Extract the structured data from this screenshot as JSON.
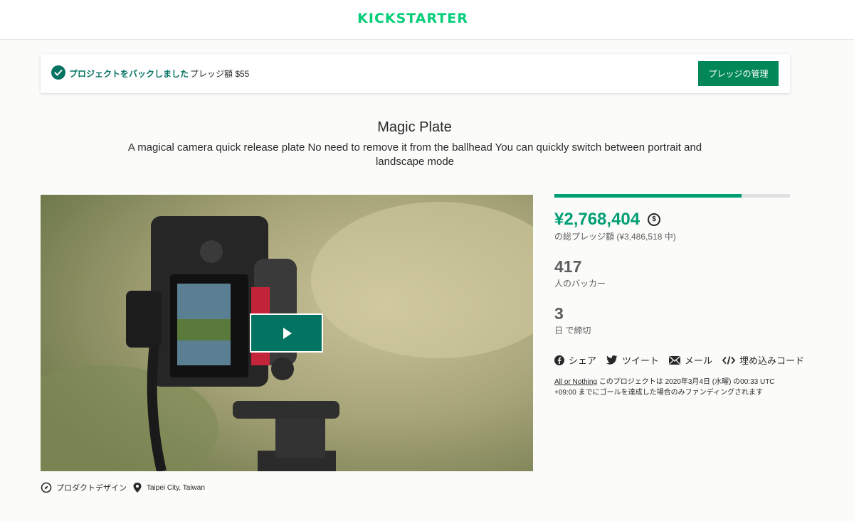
{
  "header": {
    "logo": "KICKSTARTER"
  },
  "backed": {
    "message": "プロジェクトをバックしました",
    "pledge_amount": "プレッジ額 $55",
    "manage_label": "プレッジの管理"
  },
  "project": {
    "title": "Magic Plate",
    "subtitle": "A magical camera quick release plate No need to remove it from the ballhead You can quickly switch between portrait and landscape mode",
    "category": "プロダクトデザイン",
    "location": "Taipei City, Taiwan"
  },
  "stats": {
    "progress_fraction": 0.794,
    "pledged": "¥2,768,404",
    "currency_icon": "$",
    "pledged_label": "の総プレッジ額 (¥3,486,518 中)",
    "backers": "417",
    "backers_label": "人のバッカー",
    "days": "3",
    "days_label": "日 で締切"
  },
  "share": {
    "facebook": "シェア",
    "twitter": "ツイート",
    "email": "メール",
    "embed": "埋め込みコード"
  },
  "notice": {
    "link": "All or Nothing",
    "text": " このプロジェクトは 2020年3月4日 (水曜) の00:33 UTC +09:00 までにゴールを達成した場合のみファンディングされます"
  },
  "colors": {
    "brand": "#05ce78",
    "accent": "#037362",
    "progress": "#009e74"
  }
}
